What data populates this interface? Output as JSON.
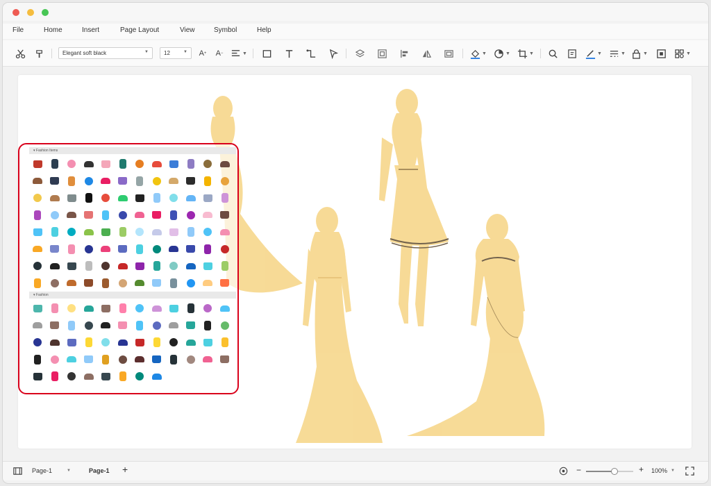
{
  "window": {
    "traffic_lights": {
      "close": "#ee5b53",
      "minimize": "#f5bd3f",
      "maximize": "#48c655"
    }
  },
  "menu": [
    {
      "id": "file",
      "label": "File"
    },
    {
      "id": "home",
      "label": "Home"
    },
    {
      "id": "insert",
      "label": "Insert"
    },
    {
      "id": "page-layout",
      "label": "Page Layout"
    },
    {
      "id": "view",
      "label": "View"
    },
    {
      "id": "symbol",
      "label": "Symbol"
    },
    {
      "id": "help",
      "label": "Help"
    }
  ],
  "toolbar": {
    "font_family": "Elegant soft black",
    "font_size": "12",
    "icons": [
      "cut-icon",
      "format-painter-icon",
      "font-size-increase-icon",
      "font-size-decrease-icon",
      "align-icon",
      "rectangle-icon",
      "text-icon",
      "connector-icon",
      "selection-icon",
      "layers-icon",
      "group-icon",
      "align-left-icon",
      "flip-icon",
      "frame-icon",
      "fill-color-icon",
      "shape-style-icon",
      "crop-icon",
      "search-icon",
      "preview-icon",
      "line-color-icon",
      "line-style-icon",
      "lock-icon",
      "fit-icon",
      "more-icon"
    ]
  },
  "library": {
    "categories": [
      {
        "name": "Fashion Items"
      },
      {
        "name": "Fashion"
      }
    ],
    "fashion_items_colors": [
      [
        "#c0392b",
        "#2c3e50",
        "#f48fb1",
        "#333333",
        "#f4a7b9",
        "#1f7a6e",
        "#e67e22",
        "#e74c3c",
        "#3b7dd8",
        "#8e7cc3",
        "#8a6d3b",
        "#6d4c41"
      ],
      [
        "#8d5a3b",
        "#2f3b52",
        "#e08e3c",
        "#1e88e5",
        "#e91e63",
        "#8a6ac8",
        "#95a5a6",
        "#f1c40f",
        "#d4a96a",
        "#2c2c2c",
        "#f4b400",
        "#e8a33d"
      ],
      [
        "#f2c94c",
        "#b07b4f",
        "#7f8c8d",
        "#111111",
        "#e74c3c",
        "#2ecc71",
        "#222222",
        "#90caf9",
        "#80deea",
        "#64b5f6",
        "#9ba8c5",
        "#ce93d8"
      ],
      [
        "#ab47bc",
        "#90caf9",
        "#795548",
        "#e57373",
        "#4fc3f7",
        "#3949ab",
        "#f06292",
        "#e91e63",
        "#3f51b5",
        "#9c27b0",
        "#f8bbd0",
        "#6d4c41"
      ],
      [
        "#4fc3f7",
        "#4dd0e1",
        "#00acc1",
        "#8bc34a",
        "#4caf50",
        "#9ccc65",
        "#b3e5fc",
        "#c5cae9",
        "#e1bee7",
        "#90caf9",
        "#4fc3f7",
        "#f48fb1"
      ],
      [
        "#f9a825",
        "#7986cb",
        "#f48fb1",
        "#283593",
        "#ec407a",
        "#5c6bc0",
        "#4dd0e1",
        "#00897b",
        "#283593",
        "#3949ab",
        "#8e24aa",
        "#c62828"
      ],
      [
        "#263238",
        "#212121",
        "#37474f",
        "#bdbdbd",
        "#4e342e",
        "#c62828",
        "#8e24aa",
        "#26a69a",
        "#80cbc4",
        "#1565c0",
        "#4dd0e1",
        "#9ccc65"
      ],
      [
        "#f9a825",
        "#8d6e63",
        "#bf6b2c",
        "#8d4b2a",
        "#9c5b2e",
        "#d4a574",
        "#558b2f",
        "#90caf9",
        "#78909c",
        "#2196f3",
        "#ffcc80",
        "#ff7043"
      ]
    ],
    "fashion_colors": [
      [
        "#4db6ac",
        "#f48fb1",
        "#ffe082",
        "#26a69a",
        "#8d6e63",
        "#ff80ab",
        "#4fc3f7",
        "#ce93d8",
        "#4dd0e1",
        "#263238",
        "#ba68c8",
        "#4fc3f7"
      ],
      [
        "#9e9e9e",
        "#8d6e63",
        "#90caf9",
        "#37474f",
        "#212121",
        "#f48fb1",
        "#4fc3f7",
        "#5c6bc0",
        "#9e9e9e",
        "#26a69a",
        "#212121",
        "#66bb6a"
      ],
      [
        "#283593",
        "#4e342e",
        "#5c6bc0",
        "#fdd835",
        "#80deea",
        "#283593",
        "#c62828",
        "#fdd835",
        "#212121",
        "#26a69a",
        "#4dd0e1",
        "#fbc02d"
      ],
      [
        "#212121",
        "#f48fb1",
        "#4dd0e1",
        "#90caf9",
        "#e0a020",
        "#6d4c41",
        "#5c2e2e",
        "#1565c0",
        "#263238",
        "#a1887f",
        "#f06292",
        "#8d6e63"
      ],
      [
        "#263238",
        "#e91e63",
        "#333333",
        "#8d6e63",
        "#37474f",
        "#f9a825",
        "#00897b",
        "#1e88e5"
      ]
    ]
  },
  "statusbar": {
    "page_selector": "Page-1",
    "page_tab": "Page-1",
    "add_page": "+",
    "zoom_minus": "−",
    "zoom_plus": "+",
    "zoom_level": "100%",
    "zoom_fraction": 0.6
  }
}
